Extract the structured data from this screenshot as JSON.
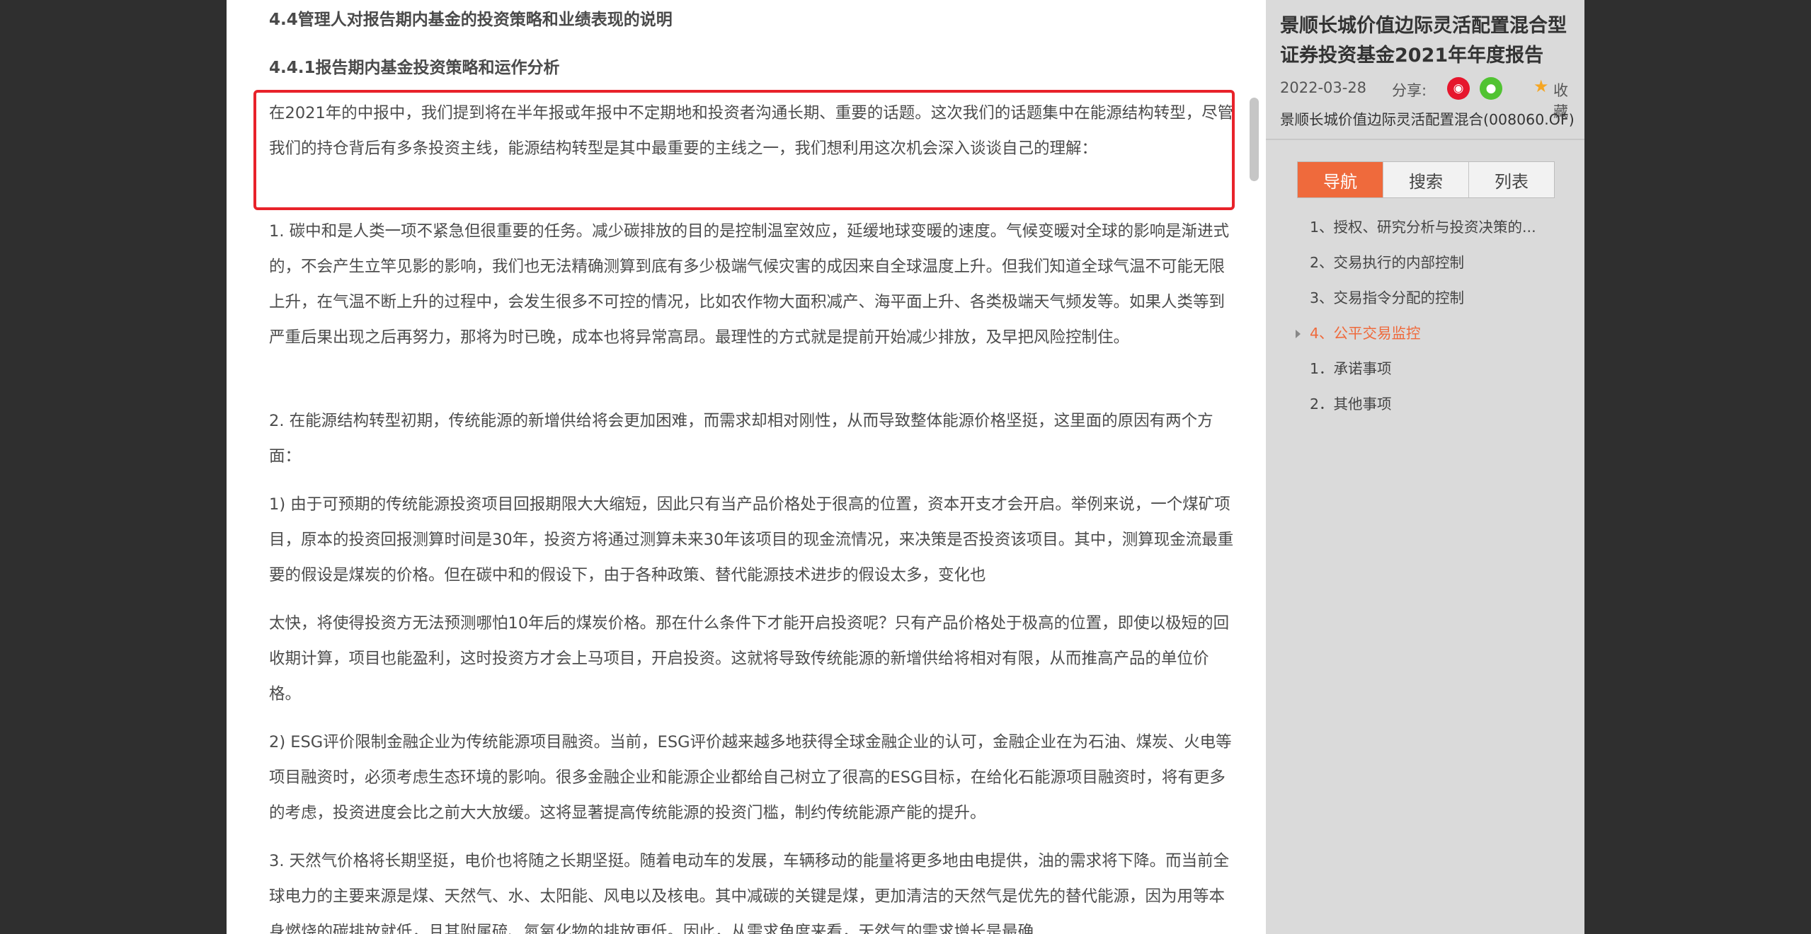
{
  "document": {
    "heading_1": "4.4管理人对报告期内基金的投资策略和业绩表现的说明",
    "heading_2": "4.4.1报告期内基金投资策略和运作分析",
    "paragraphs": [
      "在2021年的中报中，我们提到将在半年报或年报中不定期地和投资者沟通长期、重要的话题。这次我们的话题集中在能源结构转型，尽管我们的持仓背后有多条投资主线，能源结构转型是其中最重要的主线之一，我们想利用这次机会深入谈谈自己的理解：",
      "1. 碳中和是人类一项不紧急但很重要的任务。减少碳排放的目的是控制温室效应，延缓地球变暖的速度。气候变暖对全球的影响是渐进式的，不会产生立竿见影的影响，我们也无法精确测算到底有多少极端气候灾害的成因来自全球温度上升。但我们知道全球气温不可能无限上升，在气温不断上升的过程中，会发生很多不可控的情况，比如农作物大面积减产、海平面上升、各类极端天气频发等。如果人类等到严重后果出现之后再努力，那将为时已晚，成本也将异常高昂。最理性的方式就是提前开始减少排放，及早把风险控制住。",
      "2. 在能源结构转型初期，传统能源的新增供给将会更加困难，而需求却相对刚性，从而导致整体能源价格坚挺，这里面的原因有两个方面：",
      "1) 由于可预期的传统能源投资项目回报期限大大缩短，因此只有当产品价格处于很高的位置，资本开支才会开启。举例来说，一个煤矿项目，原本的投资回报测算时间是30年，投资方将通过测算未来30年该项目的现金流情况，来决策是否投资该项目。其中，测算现金流最重要的假设是煤炭的价格。但在碳中和的假设下，由于各种政策、替代能源技术进步的假设太多，变化也",
      "太快，将使得投资方无法预测哪怕10年后的煤炭价格。那在什么条件下才能开启投资呢？只有产品价格处于极高的位置，即使以极短的回收期计算，项目也能盈利，这时投资方才会上马项目，开启投资。这就将导致传统能源的新增供给将相对有限，从而推高产品的单位价格。",
      "2) ESG评价限制金融企业为传统能源项目融资。当前，ESG评价越来越多地获得全球金融企业的认可，金融企业在为石油、煤炭、火电等项目融资时，必须考虑生态环境的影响。很多金融企业和能源企业都给自己树立了很高的ESG目标，在给化石能源项目融资时，将有更多的考虑，投资进度会比之前大大放缓。这将显著提高传统能源的投资门槛，制约传统能源产能的提升。",
      "3. 天然气价格将长期坚挺，电价也将随之长期坚挺。随着电动车的发展，车辆移动的能量将更多地由电提供，油的需求将下降。而当前全球电力的主要来源是煤、天然气、水、太阳能、风电以及核电。其中减碳的关键是煤，更加清洁的天然气是优先的替代能源，因为用等本身燃烧的碳排放就低，且其附属硫、氮氧化物的排放更低。因此，从需求角度来看，天然气的需求增长是最确"
    ]
  },
  "sidebar": {
    "title": "景顺长城价值边际灵活配置混合型证券投资基金2021年年度报告",
    "date": "2022-03-28",
    "share_label": "分享:",
    "favorite_label": "收藏",
    "fund_name": "景顺长城价值边际灵活配置混合(008060.OF)",
    "tabs": [
      "导航",
      "搜索",
      "列表"
    ],
    "nav_items": [
      "1、授权、研究分析与投资决策的...",
      "2、交易执行的内部控制",
      "3、交易指令分配的控制",
      "4、公平交易监控",
      "1．承诺事项",
      "2．其他事项"
    ]
  },
  "colors": {
    "accent": "#ef6a3c",
    "highlight_border": "#e8222a",
    "weibo": "#e6162d",
    "wechat": "#51c332",
    "star": "#f5a623"
  }
}
